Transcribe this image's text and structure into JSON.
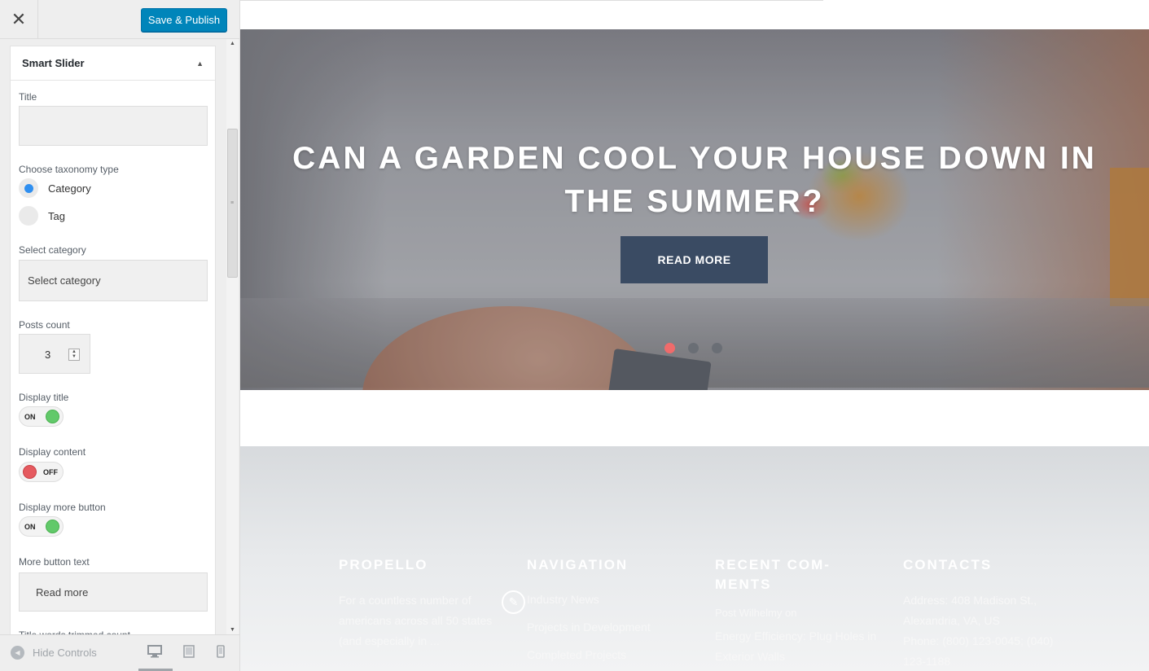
{
  "sidebar": {
    "close_icon": "close-icon",
    "publish_label": "Save & Publish",
    "section_title": "Smart Slider",
    "fields": {
      "title_label": "Title",
      "title_value": "",
      "taxonomy_label": "Choose taxonomy type",
      "taxonomy_options": [
        "Category",
        "Tag"
      ],
      "taxonomy_selected": "Category",
      "category_label": "Select category",
      "category_placeholder": "Select category",
      "posts_count_label": "Posts count",
      "posts_count_value": "3",
      "display_title_label": "Display title",
      "display_title_state": "ON",
      "display_content_label": "Display content",
      "display_content_state": "OFF",
      "display_more_label": "Display more button",
      "display_more_state": "ON",
      "more_text_label": "More button text",
      "more_text_value": "Read more",
      "cut_off_label": "Title words trimmed count"
    },
    "footer": {
      "hide_controls_label": "Hide Controls",
      "devices": [
        "desktop-icon",
        "tablet-icon",
        "mobile-icon"
      ],
      "active_device": "desktop"
    }
  },
  "preview": {
    "slide": {
      "title": "CAN A GARDEN COOL YOUR HOUSE DOWN IN THE SUMMER?",
      "button_label": "READ MORE",
      "dot_count": 3,
      "active_dot": 1
    },
    "footer_columns": {
      "about": {
        "heading": "PROPELLO",
        "text": "For a countless number of americans across all 50 states (and especially in ..."
      },
      "navigation": {
        "heading": "NAVIGATION",
        "links": [
          "Industry News",
          "Projects in Development",
          "Completed Projects"
        ]
      },
      "comments": {
        "heading": "RECENT COM-MENTS",
        "author_line": "Post Wilhelmy on",
        "link": "Energy Efficiency: Plug Holes in Exterior Walls"
      },
      "contacts": {
        "heading": "CONTACTS",
        "address": "Address: 408 Madison St., Alexandria, VA, US",
        "phone": "Phone: (800) 123-0045; (040) 123-1188"
      }
    }
  },
  "colors": {
    "publish_button": "#0085ba",
    "toggle_on": "#62c96a",
    "toggle_off": "#e55a5f",
    "radio_selected": "#2f8ff0",
    "hero_button": "#3a4b63",
    "active_dot": "#f06b6b"
  }
}
